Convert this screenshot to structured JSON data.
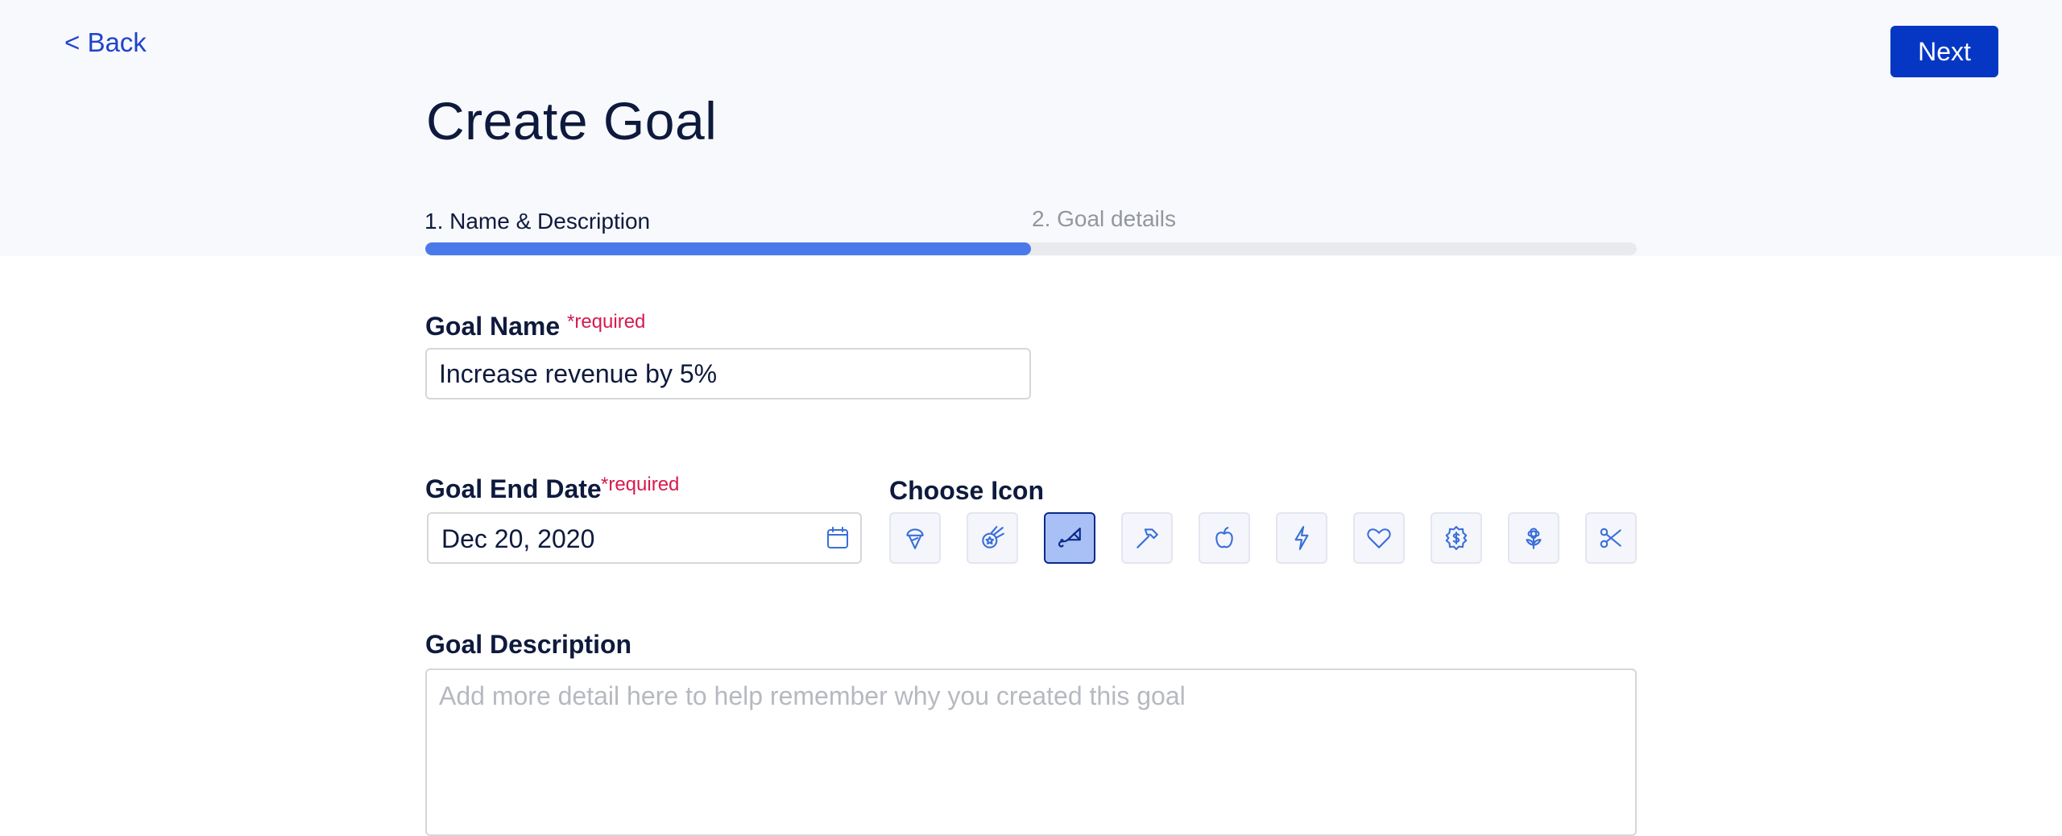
{
  "nav": {
    "back_label": "< Back",
    "next_label": "Next"
  },
  "page": {
    "title": "Create Goal"
  },
  "steps": {
    "items": [
      {
        "label": "1. Name & Description",
        "active": true
      },
      {
        "label": "2. Goal details",
        "active": false
      }
    ],
    "progress_fraction": 0.5
  },
  "goal_name": {
    "label": "Goal Name",
    "required_label": "*required",
    "value": "Increase revenue by 5%"
  },
  "end_date": {
    "label": "Goal End Date",
    "required_label": "*required",
    "value": "Dec 20, 2020",
    "icon": "calendar-icon"
  },
  "choose_icon": {
    "label": "Choose Icon",
    "selected_index": 2,
    "options": [
      "ice-cream-icon",
      "comet-icon",
      "kite-icon",
      "hammer-icon",
      "apple-icon",
      "lightning-icon",
      "heart-icon",
      "dollar-badge-icon",
      "flower-icon",
      "scissors-icon"
    ]
  },
  "description": {
    "label": "Goal Description",
    "value": "",
    "placeholder": "Add more detail here to help remember why you created this goal"
  },
  "colors": {
    "primary": "#0637c4",
    "accent": "#4a7aea",
    "required": "#d8194f",
    "icon_stroke": "#3b6fd8",
    "selected_stroke": "#0b2a8a"
  }
}
